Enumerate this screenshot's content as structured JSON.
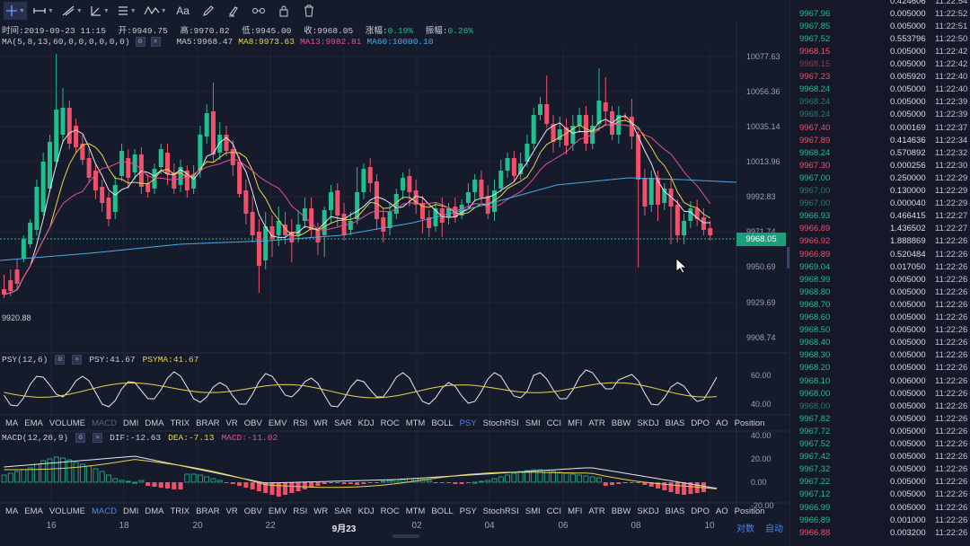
{
  "toolbar": {
    "tools": [
      "crosshair-tool",
      "horizontal-line-tool",
      "trend-line-tool",
      "angle-tool",
      "parallel-channel-tool",
      "wave-tool"
    ],
    "text_tool_label": "Aa"
  },
  "info": {
    "time_label": "时间:2019-09-23 11:15",
    "open_label": "开:9949.75",
    "high_label": "高:9970.82",
    "low_label": "低:9945.00",
    "close_label": "收:9968.05",
    "change_prefix": "涨幅:",
    "change_value": "0.19%",
    "amplitude_prefix": "振幅:",
    "amplitude_value": "0.26%"
  },
  "ma": {
    "params": "MA(5,8,13,60,0,0,0,0,0,0)",
    "ma5": "MA5:9968.47",
    "ma8": "MA8:9973.63",
    "ma13": "MA13:9982.81",
    "ma60": "MA60:10000.10"
  },
  "price_axis": [
    "10077.63",
    "10056.36",
    "10035.14",
    "10013.96",
    "9992.83",
    "9971.74",
    "9950.69",
    "9929.69",
    "9908.74"
  ],
  "last_price": "9968.05",
  "low_marker": "9920.88",
  "psy": {
    "params": "PSY(12,6)",
    "psy": "PSY:41.67",
    "psyma": "PSYMA:41.67",
    "axis": [
      "60.00",
      "40.00"
    ]
  },
  "macd": {
    "params": "MACD(12,26,9)",
    "dif": "DIF:-12.63",
    "dea": "DEA:-7.13",
    "macd": "MACD:-11.02",
    "axis": [
      "40.00",
      "20.00",
      "0.00",
      "-20.00"
    ]
  },
  "indicator_tabs": [
    "MA",
    "EMA",
    "VOLUME",
    "MACD",
    "DMI",
    "DMA",
    "TRIX",
    "BRAR",
    "VR",
    "OBV",
    "EMV",
    "RSI",
    "WR",
    "SAR",
    "KDJ",
    "ROC",
    "MTM",
    "BOLL",
    "PSY",
    "StochRSI",
    "SMI",
    "CCI",
    "MFI",
    "ATR",
    "BBW",
    "SKDJ",
    "BIAS",
    "DPO",
    "AO",
    "Position"
  ],
  "dates": [
    "16",
    "18",
    "20",
    "22",
    "9月23",
    "02",
    "04",
    "06",
    "08",
    "10"
  ],
  "bottom_buttons": {
    "log": "对数",
    "auto": "自动"
  },
  "colors": {
    "up": "#1fbf8f",
    "down": "#f0506a",
    "ma5": "#e6e8ef",
    "ma8": "#e8d44d",
    "ma13": "#e0509a",
    "ma60": "#4aa8e8"
  },
  "trades": [
    {
      "price": "",
      "qty": "0.424606",
      "time": "11:22:54",
      "side": "dn",
      "faded": false
    },
    {
      "price": "9967.96",
      "qty": "0.005000",
      "time": "11:22:52",
      "side": "up",
      "faded": false
    },
    {
      "price": "9967.85",
      "qty": "0.005000",
      "time": "11:22:51",
      "side": "up",
      "faded": false
    },
    {
      "price": "9967.52",
      "qty": "0.553796",
      "time": "11:22:50",
      "side": "up",
      "faded": false
    },
    {
      "price": "9968.15",
      "qty": "0.005000",
      "time": "11:22:42",
      "side": "dn",
      "faded": false
    },
    {
      "price": "9968.15",
      "qty": "0.005000",
      "time": "11:22:42",
      "side": "dn",
      "faded": true
    },
    {
      "price": "9967.23",
      "qty": "0.005920",
      "time": "11:22:40",
      "side": "dn",
      "faded": false
    },
    {
      "price": "9968.24",
      "qty": "0.005000",
      "time": "11:22:40",
      "side": "up",
      "faded": false
    },
    {
      "price": "9968.24",
      "qty": "0.005000",
      "time": "11:22:39",
      "side": "up",
      "faded": true
    },
    {
      "price": "9968.24",
      "qty": "0.005000",
      "time": "11:22:39",
      "side": "up",
      "faded": true
    },
    {
      "price": "9967.40",
      "qty": "0.000169",
      "time": "11:22:37",
      "side": "dn",
      "faded": false
    },
    {
      "price": "9967.89",
      "qty": "0.414636",
      "time": "11:22:34",
      "side": "dn",
      "faded": false
    },
    {
      "price": "9968.24",
      "qty": "0.570892",
      "time": "11:22:32",
      "side": "up",
      "faded": false
    },
    {
      "price": "9967.30",
      "qty": "0.000256",
      "time": "11:22:30",
      "side": "dn",
      "faded": false
    },
    {
      "price": "9967.00",
      "qty": "0.250000",
      "time": "11:22:29",
      "side": "up",
      "faded": false
    },
    {
      "price": "9967.00",
      "qty": "0.130000",
      "time": "11:22:29",
      "side": "up",
      "faded": true
    },
    {
      "price": "9967.00",
      "qty": "0.000040",
      "time": "11:22:29",
      "side": "up",
      "faded": true
    },
    {
      "price": "9966.93",
      "qty": "0.466415",
      "time": "11:22:27",
      "side": "up",
      "faded": false
    },
    {
      "price": "9966.89",
      "qty": "1.436502",
      "time": "11:22:27",
      "side": "dn",
      "faded": false
    },
    {
      "price": "9966.92",
      "qty": "1.888869",
      "time": "11:22:26",
      "side": "dn",
      "faded": false
    },
    {
      "price": "9966.89",
      "qty": "0.520484",
      "time": "11:22:26",
      "side": "dn",
      "faded": false
    },
    {
      "price": "9969.04",
      "qty": "0.017050",
      "time": "11:22:26",
      "side": "up",
      "faded": false
    },
    {
      "price": "9968.99",
      "qty": "0.005000",
      "time": "11:22:26",
      "side": "up",
      "faded": false
    },
    {
      "price": "9968.80",
      "qty": "0.005000",
      "time": "11:22:26",
      "side": "up",
      "faded": false
    },
    {
      "price": "9968.70",
      "qty": "0.005000",
      "time": "11:22:26",
      "side": "up",
      "faded": false
    },
    {
      "price": "9968.60",
      "qty": "0.005000",
      "time": "11:22:26",
      "side": "up",
      "faded": false
    },
    {
      "price": "9968.50",
      "qty": "0.005000",
      "time": "11:22:26",
      "side": "up",
      "faded": false
    },
    {
      "price": "9968.40",
      "qty": "0.005000",
      "time": "11:22:26",
      "side": "up",
      "faded": false
    },
    {
      "price": "9968.30",
      "qty": "0.005000",
      "time": "11:22:26",
      "side": "up",
      "faded": false
    },
    {
      "price": "9968.20",
      "qty": "0.005000",
      "time": "11:22:26",
      "side": "up",
      "faded": false
    },
    {
      "price": "9968.10",
      "qty": "0.006000",
      "time": "11:22:26",
      "side": "up",
      "faded": false
    },
    {
      "price": "9968.00",
      "qty": "0.005000",
      "time": "11:22:26",
      "side": "up",
      "faded": false
    },
    {
      "price": "9968.00",
      "qty": "0.005000",
      "time": "11:22:26",
      "side": "up",
      "faded": true
    },
    {
      "price": "9967.82",
      "qty": "0.005000",
      "time": "11:22:26",
      "side": "up",
      "faded": false
    },
    {
      "price": "9967.72",
      "qty": "0.005000",
      "time": "11:22:26",
      "side": "up",
      "faded": false
    },
    {
      "price": "9967.52",
      "qty": "0.005000",
      "time": "11:22:26",
      "side": "up",
      "faded": false
    },
    {
      "price": "9967.42",
      "qty": "0.005000",
      "time": "11:22:26",
      "side": "up",
      "faded": false
    },
    {
      "price": "9967.32",
      "qty": "0.005000",
      "time": "11:22:26",
      "side": "up",
      "faded": false
    },
    {
      "price": "9967.22",
      "qty": "0.005000",
      "time": "11:22:26",
      "side": "up",
      "faded": false
    },
    {
      "price": "9967.12",
      "qty": "0.005000",
      "time": "11:22:26",
      "side": "up",
      "faded": false
    },
    {
      "price": "9966.99",
      "qty": "0.005000",
      "time": "11:22:26",
      "side": "up",
      "faded": false
    },
    {
      "price": "9966.89",
      "qty": "0.001000",
      "time": "11:22:26",
      "side": "up",
      "faded": false
    },
    {
      "price": "9966.88",
      "qty": "0.003200",
      "time": "11:22:26",
      "side": "dn",
      "faded": false
    }
  ]
}
